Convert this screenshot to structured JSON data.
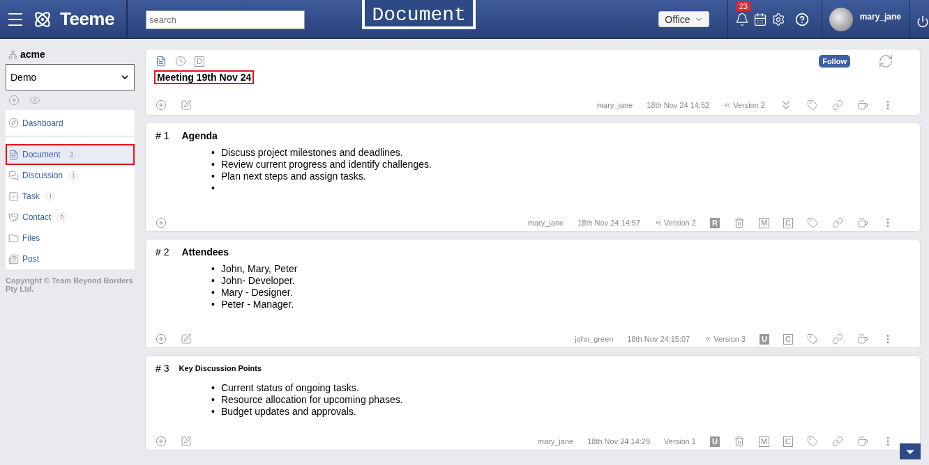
{
  "header": {
    "brand": "Teeme",
    "search": {
      "placeholder": "search"
    },
    "page_title": "Document",
    "workplace": "Office",
    "notifications": "23",
    "user": "mary_jane"
  },
  "sidebar": {
    "org": "acme",
    "space": "Demo",
    "items": [
      {
        "label": "Dashboard",
        "selected": false
      },
      {
        "label": "Document",
        "count": "3",
        "selected": true
      },
      {
        "label": "Discussion",
        "count": "1",
        "selected": false
      },
      {
        "label": "Task",
        "count": "1",
        "selected": false
      },
      {
        "label": "Contact",
        "count": "0",
        "selected": false
      },
      {
        "label": "Files",
        "selected": false
      },
      {
        "label": "Post",
        "selected": false
      }
    ],
    "copyright": "Copyright © Team Beyond Borders Pty Ltd."
  },
  "document": {
    "tabs": [
      {
        "selected": true
      },
      {
        "selected": false
      },
      {
        "text": "D",
        "selected": false
      }
    ],
    "follow": "Follow",
    "title": "Meeting 19th Nov 24",
    "author": "mary_jane",
    "date": "18th Nov 24 14:52",
    "version": "Version 2",
    "version_history": true,
    "editable": true
  },
  "sections": [
    {
      "kind": "heading",
      "number": "# 1",
      "heading": "Agenda",
      "bullets": [
        {
          "marker": "•",
          "text": "Discuss project milestones and deadlines."
        },
        {
          "marker": "•",
          "text": "Review current progress and identify challenges."
        },
        {
          "marker": "•",
          "text": "Plan next steps and assign tasks."
        },
        {
          "marker": "•"
        }
      ],
      "editable": false,
      "author": "mary_jane",
      "date": "18th Nov 24 14:57",
      "version": "Version 2",
      "version_history": true,
      "badges": [
        {
          "kind": "solid",
          "text": "R"
        },
        {
          "kind": "trash"
        },
        {
          "kind": "outline",
          "text": "M"
        },
        {
          "kind": "outline",
          "text": "C"
        }
      ]
    },
    {
      "kind": "heading",
      "number": "# 2",
      "heading": "Attendees",
      "bullets": [
        {
          "marker": "•",
          "text": "John, Mary, Peter"
        },
        {
          "marker": "•",
          "text": "John- Developer."
        },
        {
          "marker": "•",
          "text": "Mary - Designer."
        },
        {
          "marker": "•",
          "text": "Peter - Manager."
        }
      ],
      "editable": true,
      "author": "john_green",
      "date": "18th Nov 24 15:07",
      "version": "Version 3",
      "version_history": true,
      "badges": [
        {
          "kind": "solid",
          "text": "U"
        },
        {
          "kind": "outline",
          "text": "C"
        }
      ]
    },
    {
      "kind": "subheading",
      "number": "# 3",
      "heading": "Key Discussion Points",
      "bullets": [
        {
          "marker": "•",
          "text": "Current status of ongoing tasks."
        },
        {
          "marker": "•",
          "text": "Resource allocation for upcoming phases."
        },
        {
          "marker": "•",
          "text": "Budget updates and approvals."
        }
      ],
      "editable": true,
      "author": "mary_jane",
      "date": "18th Nov 24 14:29",
      "version": "Version 1",
      "version_history": false,
      "badges": [
        {
          "kind": "solid",
          "text": "U"
        },
        {
          "kind": "trash"
        },
        {
          "kind": "outline",
          "text": "M"
        },
        {
          "kind": "outline",
          "text": "C"
        }
      ]
    }
  ]
}
